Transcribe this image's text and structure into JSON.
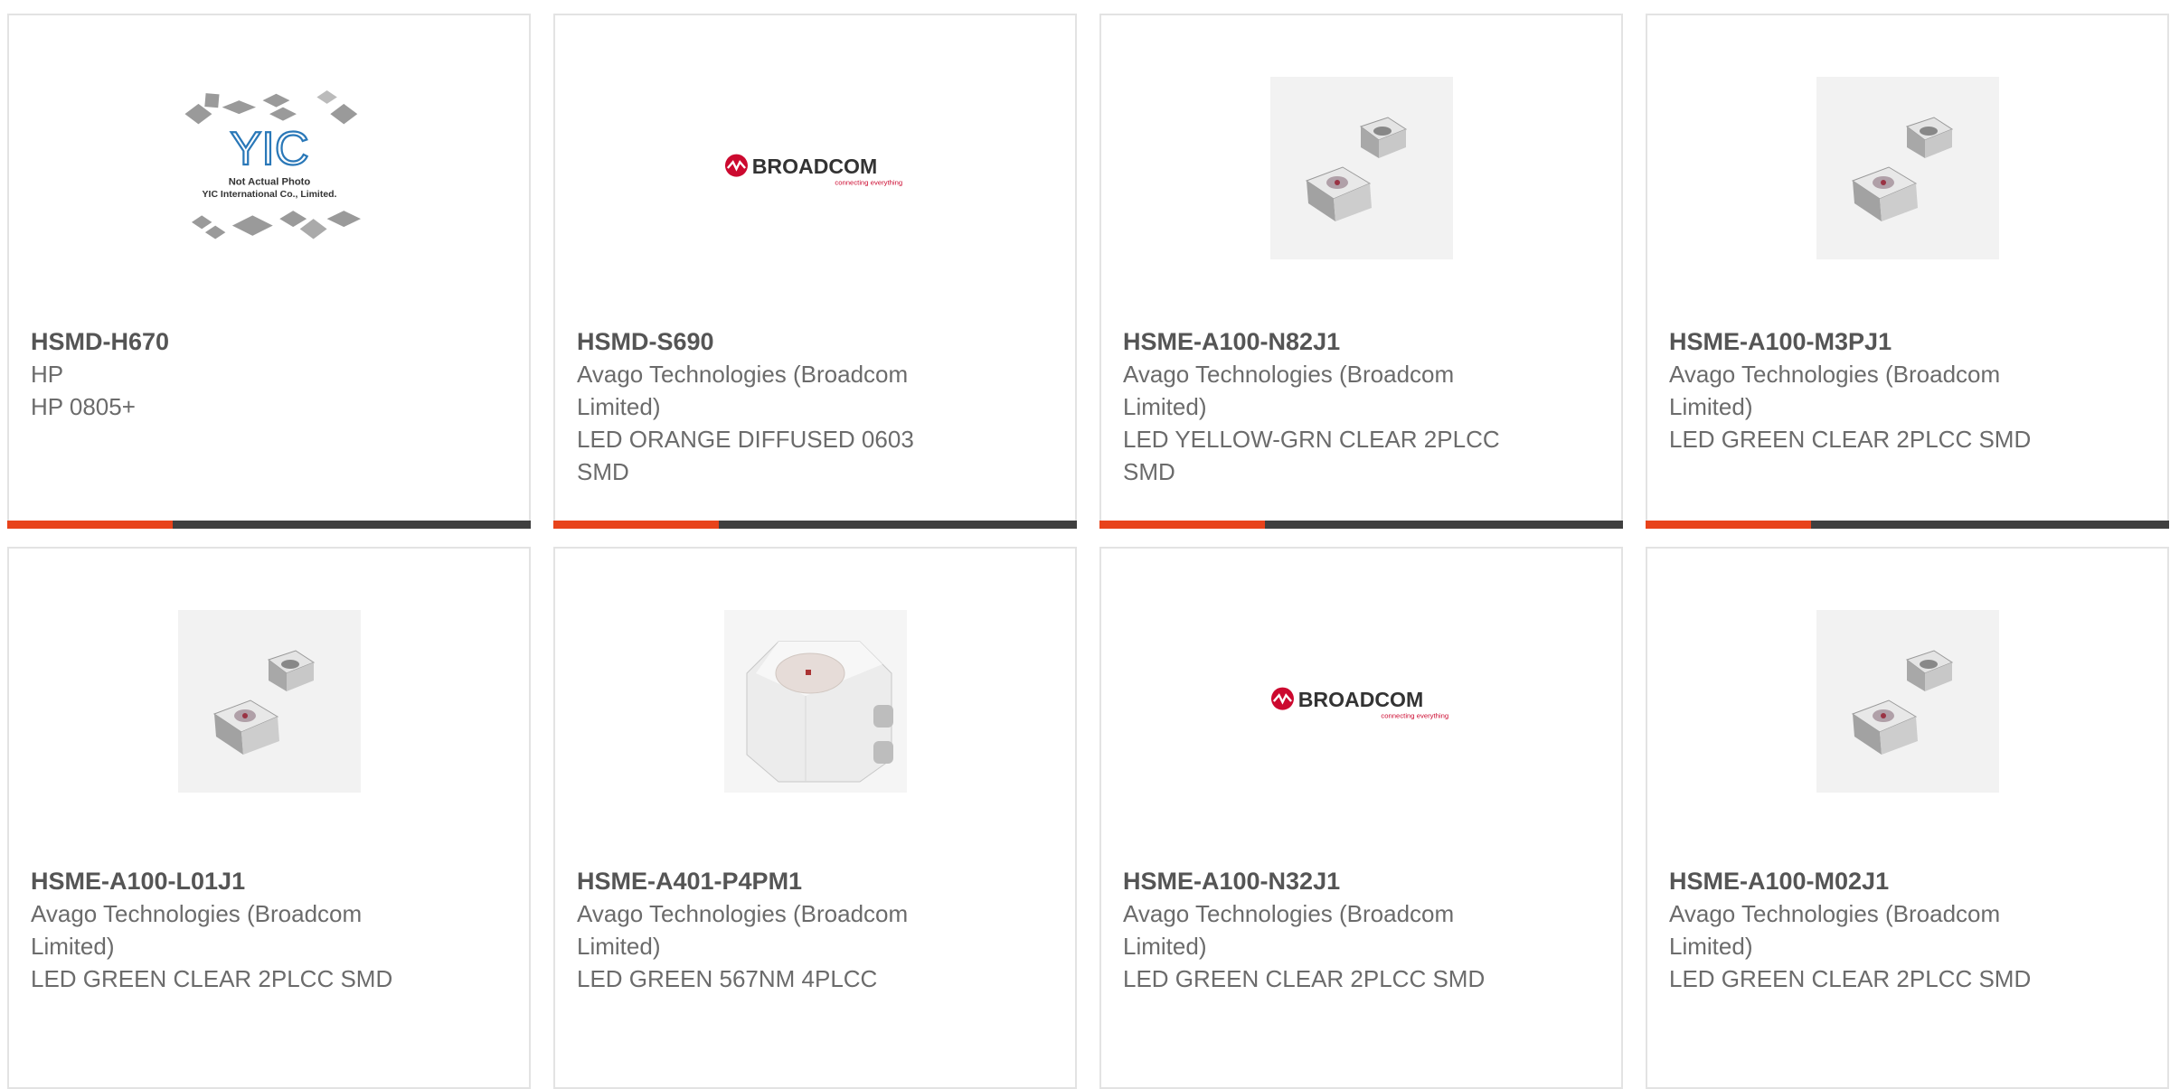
{
  "products": [
    {
      "part": "HSMD-H670",
      "manufacturer": "HP",
      "description": "HP 0805+",
      "image": "yic-placeholder",
      "placeholder_line1": "Not Actual Photo",
      "placeholder_line2": "YIC International Co., Limited.",
      "placeholder_logo": "YIC"
    },
    {
      "part": "HSMD-S690",
      "manufacturer": "Avago Technologies (Broadcom Limited)",
      "description": "LED ORANGE DIFFUSED 0603 SMD",
      "image": "broadcom-logo",
      "logo_text": "BROADCOM",
      "logo_tagline": "connecting everything"
    },
    {
      "part": "HSME-A100-N82J1",
      "manufacturer": "Avago Technologies (Broadcom Limited)",
      "description": "LED YELLOW-GRN CLEAR 2PLCC SMD",
      "image": "led-2plcc"
    },
    {
      "part": "HSME-A100-M3PJ1",
      "manufacturer": "Avago Technologies (Broadcom Limited)",
      "description": "LED GREEN CLEAR 2PLCC SMD",
      "image": "led-2plcc"
    },
    {
      "part": "HSME-A100-L01J1",
      "manufacturer": "Avago Technologies (Broadcom Limited)",
      "description": "LED GREEN CLEAR 2PLCC SMD",
      "image": "led-2plcc"
    },
    {
      "part": "HSME-A401-P4PM1",
      "manufacturer": "Avago Technologies (Broadcom Limited)",
      "description": "LED GREEN 567NM 4PLCC",
      "image": "led-4plcc"
    },
    {
      "part": "HSME-A100-N32J1",
      "manufacturer": "Avago Technologies (Broadcom Limited)",
      "description": "LED GREEN CLEAR 2PLCC SMD",
      "image": "broadcom-logo",
      "logo_text": "BROADCOM",
      "logo_tagline": "connecting everything"
    },
    {
      "part": "HSME-A100-M02J1",
      "manufacturer": "Avago Technologies (Broadcom Limited)",
      "description": "LED GREEN CLEAR 2PLCC SMD",
      "image": "led-2plcc"
    }
  ],
  "colors": {
    "accent": "#e8431b",
    "bar": "#3f3f3f",
    "border": "#e3e3e3",
    "broadcom_red": "#cc092f"
  }
}
